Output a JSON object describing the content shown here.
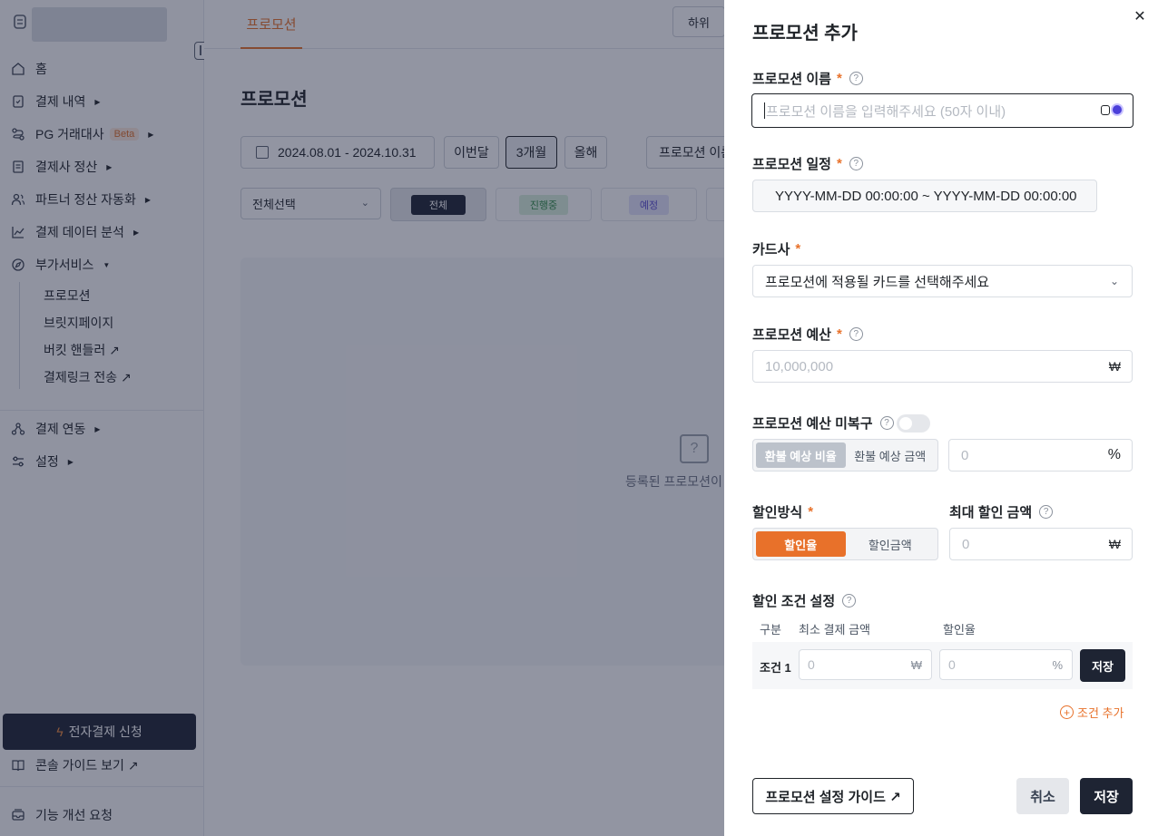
{
  "sidebar": {
    "items": [
      {
        "label": "홈",
        "icon": "home-icon"
      },
      {
        "label": "결제 내역",
        "icon": "receipt-icon"
      },
      {
        "label": "PG 거래대사",
        "icon": "route-icon",
        "badge": "Beta"
      },
      {
        "label": "결제사 정산",
        "icon": "ledger-icon"
      },
      {
        "label": "파트너 정산 자동화",
        "icon": "users-icon"
      },
      {
        "label": "결제 데이터 분석",
        "icon": "chart-icon"
      },
      {
        "label": "부가서비스",
        "icon": "compass-icon"
      },
      {
        "label": "결제 연동",
        "icon": "plug-icon"
      },
      {
        "label": "설정",
        "icon": "sliders-icon"
      }
    ],
    "sub_items": [
      "프로모션",
      "브릿지페이지",
      "버킷 핸들러 ↗",
      "결제링크 전송 ↗"
    ],
    "apply_button": "전자결제 신청",
    "console_guide": "콘솔 가이드 보기 ↗",
    "feature_request": "기능 개선 요청"
  },
  "main": {
    "tab": "프로모션",
    "sub_button": "하위",
    "title": "프로모션",
    "date_range": "2024.08.01 - 2024.10.31",
    "period_buttons": [
      "이번달",
      "3개월",
      "올해"
    ],
    "name_filter": "프로모션 이름",
    "select_all": "전체선택",
    "status_tabs": [
      "전체",
      "진행중",
      "예정"
    ],
    "empty_text": "등록된 프로모션이 없"
  },
  "drawer": {
    "title": "프로모션 추가",
    "name": {
      "label": "프로모션 이름",
      "placeholder": "프로모션 이름을 입력해주세요 (50자 이내)"
    },
    "schedule": {
      "label": "프로모션 일정",
      "value": "YYYY-MM-DD 00:00:00 ~ YYYY-MM-DD 00:00:00"
    },
    "card": {
      "label": "카드사",
      "value": "프로모션에 적용될 카드를 선택해주세요"
    },
    "budget": {
      "label": "프로모션 예산",
      "placeholder": "10,000,000",
      "unit": "₩"
    },
    "refund": {
      "label": "프로모션 예산 미복구",
      "options": [
        "환불 예상 비율",
        "환불 예상 금액"
      ],
      "placeholder": "0",
      "unit": "%"
    },
    "discount": {
      "label": "할인방식",
      "options": [
        "할인율",
        "할인금액"
      ]
    },
    "max_discount": {
      "label": "최대 할인 금액",
      "placeholder": "0",
      "unit": "₩"
    },
    "conditions": {
      "label": "할인 조건 설정",
      "headers": [
        "구분",
        "최소 결제 금액",
        "할인율"
      ],
      "row_label": "조건 1",
      "min_placeholder": "0",
      "min_unit": "₩",
      "rate_placeholder": "0",
      "rate_unit": "%",
      "save": "저장",
      "add": "조건 추가"
    },
    "guide_button": "프로모션 설정 가이드 ↗",
    "cancel_button": "취소",
    "save_button": "저장"
  },
  "colors": {
    "accent": "#e8712a",
    "dark": "#1e2433",
    "overlay": "rgba(28,33,60,0.48)"
  }
}
